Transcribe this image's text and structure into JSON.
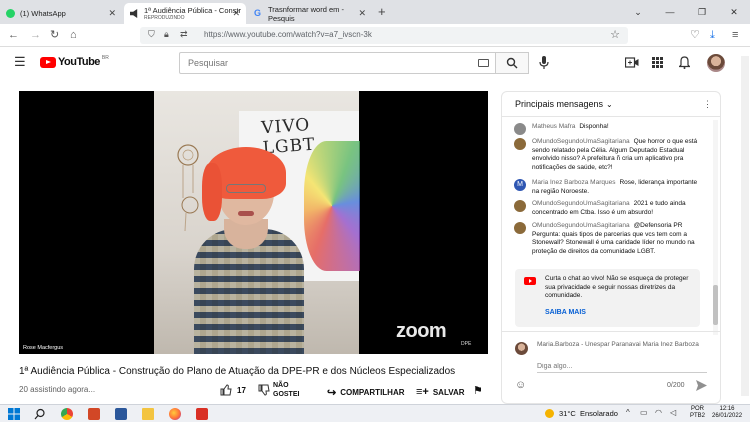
{
  "browser": {
    "tabs": [
      {
        "label": "(1) WhatsApp"
      },
      {
        "label": "1ª Audiência Pública - Constr",
        "sub": "REPRODUZINDO"
      },
      {
        "label": "Trasnformar word em - Pesquis"
      }
    ],
    "new_tab": "+",
    "url": "https://www.youtube.com/watch?v=a7_ivscn-3k"
  },
  "youtube": {
    "logo": "YouTube",
    "region": "BR",
    "search_placeholder": "Pesquisar"
  },
  "video": {
    "speaker_label": "Rose Macfergus",
    "banner_text": "VIVO LGBT",
    "zoom_logo": "zoom",
    "zoom_corner": "DPE",
    "title": "1ª Audiência Pública - Construção do Plano de Atuação da DPE-PR e dos Núcleos Especializados",
    "viewers": "20 assistindo agora...",
    "likes": "17",
    "dislike_label": "NÃO GOSTEI",
    "share_label": "COMPARTILHAR",
    "save_label": "SALVAR"
  },
  "chat": {
    "header": "Principais mensagens",
    "messages": [
      {
        "author": "Matheus Mafra",
        "text": "Disponha!",
        "color": "#8a8a8a"
      },
      {
        "author": "OMundoSegundoUmaSagitariana",
        "text": "Que horror o que está sendo relatado pela Célia. Algum Deputado Estadual envolvido nisso? A prefeitura ñ cria um aplicativo pra notificações de saúde, etc?!",
        "color": "#8b6a3a"
      },
      {
        "author": "Maria Inez Barboza Marques",
        "text": "Rose, liderança importante na região Noroeste.",
        "color": "#2f57b3",
        "initial": "M"
      },
      {
        "author": "OMundoSegundoUmaSagitariana",
        "text": "2021 e tudo ainda concentrado em Ctba. Isso é um absurdo!",
        "color": "#8b6a3a"
      },
      {
        "author": "OMundoSegundoUmaSagitariana",
        "text": "@Defensoria PR Pergunta: quais tipos de parcerias que vcs tem com a Stonewall? Stonewall é uma caridade líder no mundo na proteção de direitos da comunidade LGBT.",
        "color": "#8b6a3a"
      }
    ],
    "notice": "Curta o chat ao vivo! Não se esqueça de proteger sua privacidade e seguir nossas diretrizes da comunidade.",
    "notice_link": "SAIBA MAIS",
    "current_user": "Maria.Barboza - Unespar Paranavai Maria Inez Barboza",
    "input_placeholder": "Diga algo...",
    "char_count": "0/200"
  },
  "taskbar": {
    "temperature": "31°C",
    "weather": "Ensolarado",
    "lang1": "POR",
    "lang2": "PTB2",
    "time": "12:16",
    "date": "26/01/2022"
  }
}
